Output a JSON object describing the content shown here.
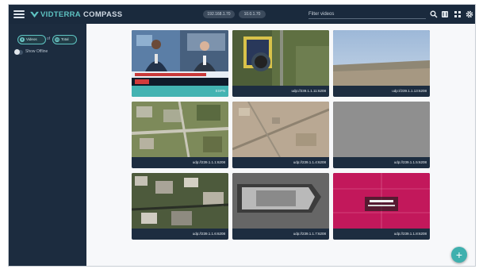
{
  "app": {
    "brand_accent": "VIDTERRA",
    "brand_main": "COMPASS",
    "accent_color": "#3fb0ae",
    "topbar_color": "#1a2a3d"
  },
  "topbar": {
    "ip_pills": [
      "192.168.1.70",
      "10.0.1.70"
    ],
    "filter_placeholder": "Filter videos",
    "icons": [
      "menu-icon",
      "search-icon",
      "map-icon",
      "grid-icon",
      "settings-icon"
    ]
  },
  "sidebar": {
    "videos_count": "9",
    "videos_label": "Videos",
    "of_label": "of",
    "total_count": "11",
    "total_label": "Total",
    "show_offline_label": "Show Offline"
  },
  "videos": [
    {
      "caption": "ESPN",
      "thumb": "news-studio"
    },
    {
      "caption": "udp://239.1.1.11:6208",
      "thumb": "aerial-rooftop"
    },
    {
      "caption": "udp://239.1.1.13:6208",
      "thumb": "aerial-horizon"
    },
    {
      "caption": "udp://239.1.1.1:6208",
      "thumb": "aerial-neighborhood"
    },
    {
      "caption": "udp://239.1.1.4:6208",
      "thumb": "aerial-desert"
    },
    {
      "caption": "udp://239.1.1.5:6208",
      "thumb": "no-signal"
    },
    {
      "caption": "udp://239.1.1.6:6208",
      "thumb": "aerial-city"
    },
    {
      "caption": "udp://239.1.1.7:6208",
      "thumb": "aerial-stadium"
    },
    {
      "caption": "udp://239.1.1.8:6208",
      "thumb": "thermal-overlay"
    }
  ],
  "fab": {
    "icon": "plus-icon",
    "label": "+"
  }
}
